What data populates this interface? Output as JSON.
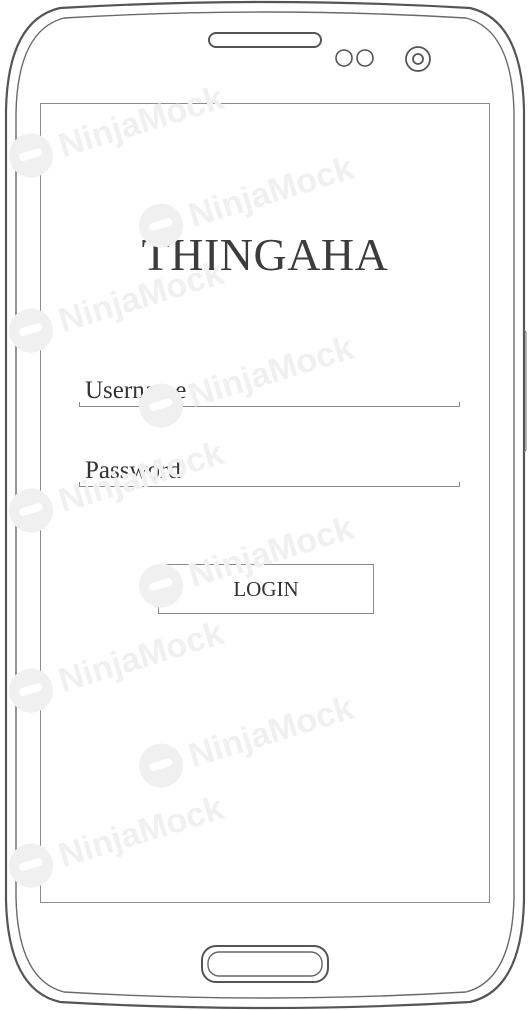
{
  "watermark": {
    "text": "NinjaMock"
  },
  "app": {
    "title": "THINGAHA"
  },
  "form": {
    "username_label": "Username",
    "password_label": "Password",
    "login_label": "LOGIN"
  },
  "colors": {
    "outline": "#555555",
    "text": "#333333",
    "watermark": "#f0f0f0"
  }
}
